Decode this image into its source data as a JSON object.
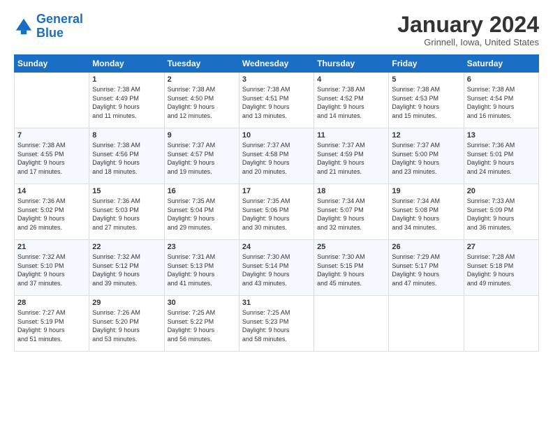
{
  "header": {
    "logo_line1": "General",
    "logo_line2": "Blue",
    "month_title": "January 2024",
    "location": "Grinnell, Iowa, United States"
  },
  "days_of_week": [
    "Sunday",
    "Monday",
    "Tuesday",
    "Wednesday",
    "Thursday",
    "Friday",
    "Saturday"
  ],
  "weeks": [
    [
      {
        "day": "",
        "info": ""
      },
      {
        "day": "1",
        "info": "Sunrise: 7:38 AM\nSunset: 4:49 PM\nDaylight: 9 hours\nand 11 minutes."
      },
      {
        "day": "2",
        "info": "Sunrise: 7:38 AM\nSunset: 4:50 PM\nDaylight: 9 hours\nand 12 minutes."
      },
      {
        "day": "3",
        "info": "Sunrise: 7:38 AM\nSunset: 4:51 PM\nDaylight: 9 hours\nand 13 minutes."
      },
      {
        "day": "4",
        "info": "Sunrise: 7:38 AM\nSunset: 4:52 PM\nDaylight: 9 hours\nand 14 minutes."
      },
      {
        "day": "5",
        "info": "Sunrise: 7:38 AM\nSunset: 4:53 PM\nDaylight: 9 hours\nand 15 minutes."
      },
      {
        "day": "6",
        "info": "Sunrise: 7:38 AM\nSunset: 4:54 PM\nDaylight: 9 hours\nand 16 minutes."
      }
    ],
    [
      {
        "day": "7",
        "info": "Sunrise: 7:38 AM\nSunset: 4:55 PM\nDaylight: 9 hours\nand 17 minutes."
      },
      {
        "day": "8",
        "info": "Sunrise: 7:38 AM\nSunset: 4:56 PM\nDaylight: 9 hours\nand 18 minutes."
      },
      {
        "day": "9",
        "info": "Sunrise: 7:37 AM\nSunset: 4:57 PM\nDaylight: 9 hours\nand 19 minutes."
      },
      {
        "day": "10",
        "info": "Sunrise: 7:37 AM\nSunset: 4:58 PM\nDaylight: 9 hours\nand 20 minutes."
      },
      {
        "day": "11",
        "info": "Sunrise: 7:37 AM\nSunset: 4:59 PM\nDaylight: 9 hours\nand 21 minutes."
      },
      {
        "day": "12",
        "info": "Sunrise: 7:37 AM\nSunset: 5:00 PM\nDaylight: 9 hours\nand 23 minutes."
      },
      {
        "day": "13",
        "info": "Sunrise: 7:36 AM\nSunset: 5:01 PM\nDaylight: 9 hours\nand 24 minutes."
      }
    ],
    [
      {
        "day": "14",
        "info": "Sunrise: 7:36 AM\nSunset: 5:02 PM\nDaylight: 9 hours\nand 26 minutes."
      },
      {
        "day": "15",
        "info": "Sunrise: 7:36 AM\nSunset: 5:03 PM\nDaylight: 9 hours\nand 27 minutes."
      },
      {
        "day": "16",
        "info": "Sunrise: 7:35 AM\nSunset: 5:04 PM\nDaylight: 9 hours\nand 29 minutes."
      },
      {
        "day": "17",
        "info": "Sunrise: 7:35 AM\nSunset: 5:06 PM\nDaylight: 9 hours\nand 30 minutes."
      },
      {
        "day": "18",
        "info": "Sunrise: 7:34 AM\nSunset: 5:07 PM\nDaylight: 9 hours\nand 32 minutes."
      },
      {
        "day": "19",
        "info": "Sunrise: 7:34 AM\nSunset: 5:08 PM\nDaylight: 9 hours\nand 34 minutes."
      },
      {
        "day": "20",
        "info": "Sunrise: 7:33 AM\nSunset: 5:09 PM\nDaylight: 9 hours\nand 36 minutes."
      }
    ],
    [
      {
        "day": "21",
        "info": "Sunrise: 7:32 AM\nSunset: 5:10 PM\nDaylight: 9 hours\nand 37 minutes."
      },
      {
        "day": "22",
        "info": "Sunrise: 7:32 AM\nSunset: 5:12 PM\nDaylight: 9 hours\nand 39 minutes."
      },
      {
        "day": "23",
        "info": "Sunrise: 7:31 AM\nSunset: 5:13 PM\nDaylight: 9 hours\nand 41 minutes."
      },
      {
        "day": "24",
        "info": "Sunrise: 7:30 AM\nSunset: 5:14 PM\nDaylight: 9 hours\nand 43 minutes."
      },
      {
        "day": "25",
        "info": "Sunrise: 7:30 AM\nSunset: 5:15 PM\nDaylight: 9 hours\nand 45 minutes."
      },
      {
        "day": "26",
        "info": "Sunrise: 7:29 AM\nSunset: 5:17 PM\nDaylight: 9 hours\nand 47 minutes."
      },
      {
        "day": "27",
        "info": "Sunrise: 7:28 AM\nSunset: 5:18 PM\nDaylight: 9 hours\nand 49 minutes."
      }
    ],
    [
      {
        "day": "28",
        "info": "Sunrise: 7:27 AM\nSunset: 5:19 PM\nDaylight: 9 hours\nand 51 minutes."
      },
      {
        "day": "29",
        "info": "Sunrise: 7:26 AM\nSunset: 5:20 PM\nDaylight: 9 hours\nand 53 minutes."
      },
      {
        "day": "30",
        "info": "Sunrise: 7:25 AM\nSunset: 5:22 PM\nDaylight: 9 hours\nand 56 minutes."
      },
      {
        "day": "31",
        "info": "Sunrise: 7:25 AM\nSunset: 5:23 PM\nDaylight: 9 hours\nand 58 minutes."
      },
      {
        "day": "",
        "info": ""
      },
      {
        "day": "",
        "info": ""
      },
      {
        "day": "",
        "info": ""
      }
    ]
  ]
}
